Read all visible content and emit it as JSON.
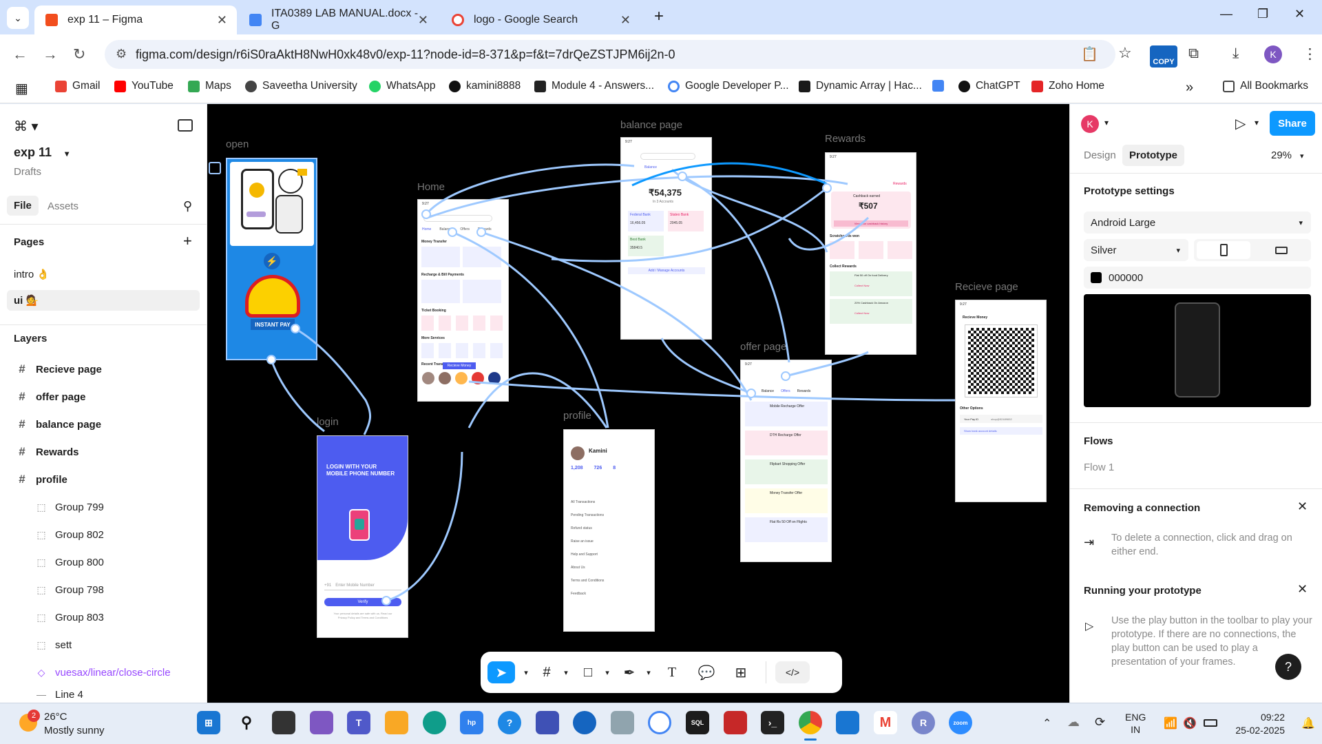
{
  "browser": {
    "tabs": [
      {
        "title": "exp 11 – Figma",
        "active": true,
        "favicon_color": "#f24e1e"
      },
      {
        "title": "ITA0389 LAB MANUAL.docx - G",
        "active": false,
        "favicon_color": "#4285f4"
      },
      {
        "title": "logo - Google Search",
        "active": false,
        "favicon_color": "#ea4335"
      }
    ],
    "url": "figma.com/design/r6iS0raAktH8NwH0xk48v0/exp-11?node-id=8-371&p=f&t=7drQeZSTJPM6ij2n-0",
    "copy_badge": "COPY",
    "profile_initial": "K",
    "bookmarks": [
      {
        "label": "Gmail",
        "color": "#ea4335"
      },
      {
        "label": "YouTube",
        "color": "#ff0000"
      },
      {
        "label": "Maps",
        "color": "#34a853"
      },
      {
        "label": "Saveetha University",
        "color": "#444444"
      },
      {
        "label": "WhatsApp",
        "color": "#25d366"
      },
      {
        "label": "kamini8888",
        "color": "#111111"
      },
      {
        "label": "Module 4 - Answers...",
        "color": "#222222"
      },
      {
        "label": "Google Developer P...",
        "color": "#4285f4"
      },
      {
        "label": "Dynamic Array | Hac...",
        "color": "#1a1a1a"
      },
      {
        "label": "",
        "color": "#4285f4"
      },
      {
        "label": "ChatGPT",
        "color": "#111111"
      },
      {
        "label": "Zoho Home",
        "color": "#e42527"
      }
    ],
    "all_bookmarks": "All Bookmarks"
  },
  "left_panel": {
    "file_name": "exp 11",
    "drafts": "Drafts",
    "tab_file": "File",
    "tab_assets": "Assets",
    "pages_title": "Pages",
    "pages": [
      {
        "label": "intro 👌",
        "selected": false
      },
      {
        "label": "ui 💁",
        "selected": true
      }
    ],
    "layers_title": "Layers",
    "layers": [
      {
        "label": "Recieve page",
        "kind": "frame"
      },
      {
        "label": "offer page",
        "kind": "frame"
      },
      {
        "label": "balance page",
        "kind": "frame"
      },
      {
        "label": "Rewards",
        "kind": "frame"
      },
      {
        "label": "profile",
        "kind": "frame"
      },
      {
        "label": "Group 799",
        "kind": "group"
      },
      {
        "label": "Group 802",
        "kind": "group"
      },
      {
        "label": "Group 800",
        "kind": "group"
      },
      {
        "label": "Group 798",
        "kind": "group"
      },
      {
        "label": "Group 803",
        "kind": "group"
      },
      {
        "label": "sett",
        "kind": "group"
      },
      {
        "label": "vuesax/linear/close-circle",
        "kind": "component"
      },
      {
        "label": "Line 4",
        "kind": "group"
      }
    ]
  },
  "canvas": {
    "frames": {
      "open": "open",
      "home": "Home",
      "login": "login",
      "balance": "balance page",
      "profile": "profile",
      "rewards": "Rewards",
      "offer": "offer page",
      "recieve": "Recieve page"
    },
    "open_frame": {
      "button": "INSTANT PAY"
    },
    "login_frame": {
      "title": "LOGIN WITH YOUR MOBILE PHONE NUMBER",
      "prefix": "+91",
      "placeholder": "Enter Mobile Number",
      "button": "Verify",
      "footer": "Your personal details are safe with us. Read our Privacy Policy and Terms and Conditions"
    },
    "home_frame": {
      "time": "9:27",
      "tabs": [
        "Home",
        "Balance",
        "Offers",
        "Rewards"
      ],
      "sections": [
        "Money Transfer",
        "Recharge & Bill Payments",
        "Ticket Booking",
        "More Services",
        "Recent Transactions"
      ],
      "receive_money": "Recieve Money"
    },
    "balance_frame": {
      "time": "9:27",
      "tab": "Balance",
      "balance": "₹54,375",
      "accounts": "In 3 Accounts",
      "banks": [
        {
          "name": "Federal Bank",
          "amount": "16,456.05"
        },
        {
          "name": "Stateo Bank",
          "amount": "2045.05"
        },
        {
          "name": "Best Bank",
          "amount": "35840.5"
        }
      ],
      "manage": "Add / Manage Accounts"
    },
    "rewards_frame": {
      "time": "9:27",
      "tab": "Rewards",
      "cashback_label": "Cashback earned",
      "cashback": "₹507",
      "history": "View your cashback history",
      "scratch": "Scratchcards won",
      "collect": "Collect Rewards",
      "offers": [
        "Flat 50 off On food Delivery",
        "20% Cashback On Amazon"
      ],
      "collect_btn": "Collect Now"
    },
    "offer_frame": {
      "time": "9:27",
      "tabs": [
        "Balance",
        "Offers",
        "Rewards"
      ],
      "offers": [
        "Mobile Recharge Offer",
        "DTH Recharge Offer",
        "Flipkart Shopping Offer",
        "Money Transfer Offer",
        "Flat Rs 50 Off on Flights"
      ]
    },
    "recieve_frame": {
      "time": "9:27",
      "title": "Recieve Money",
      "other": "Other Options",
      "pay_id": "Your Pay ID",
      "pay_value": "shop@52489652",
      "bank_link": "Show bank account details"
    },
    "profile_frame": {
      "name": "Kamini",
      "stats": [
        "1,208",
        "726",
        "8"
      ],
      "items": [
        "All Transactions",
        "Pending Transactions",
        "Refund status",
        "Raise an issue",
        "Help and Support",
        "About Us",
        "Terms and Conditions",
        "Feedback"
      ]
    }
  },
  "right_panel": {
    "avatar": "K",
    "share": "Share",
    "tab_design": "Design",
    "tab_prototype": "Prototype",
    "zoom": "29%",
    "settings_title": "Prototype settings",
    "device": "Android Large",
    "model": "Silver",
    "bg_hex": "000000",
    "flows_title": "Flows",
    "flow_1": "Flow 1",
    "removing_title": "Removing a connection",
    "removing_text": "To delete a connection, click and drag on either end.",
    "running_title": "Running your prototype",
    "running_text": "Use the play button in the toolbar to play your prototype. If there are no connections, the play button can be used to play a presentation of your frames.",
    "help": "?"
  },
  "taskbar": {
    "weather_temp": "26°C",
    "weather_desc": "Mostly sunny",
    "weather_badge": "2",
    "lang_top": "ENG",
    "lang_bottom": "IN",
    "time": "09:22",
    "date": "25-02-2025"
  },
  "colors": {
    "accent": "#0d99ff",
    "link": "#9ec9ff",
    "frame_blue": "#1e88e5",
    "login_purple": "#4d5cf0"
  }
}
